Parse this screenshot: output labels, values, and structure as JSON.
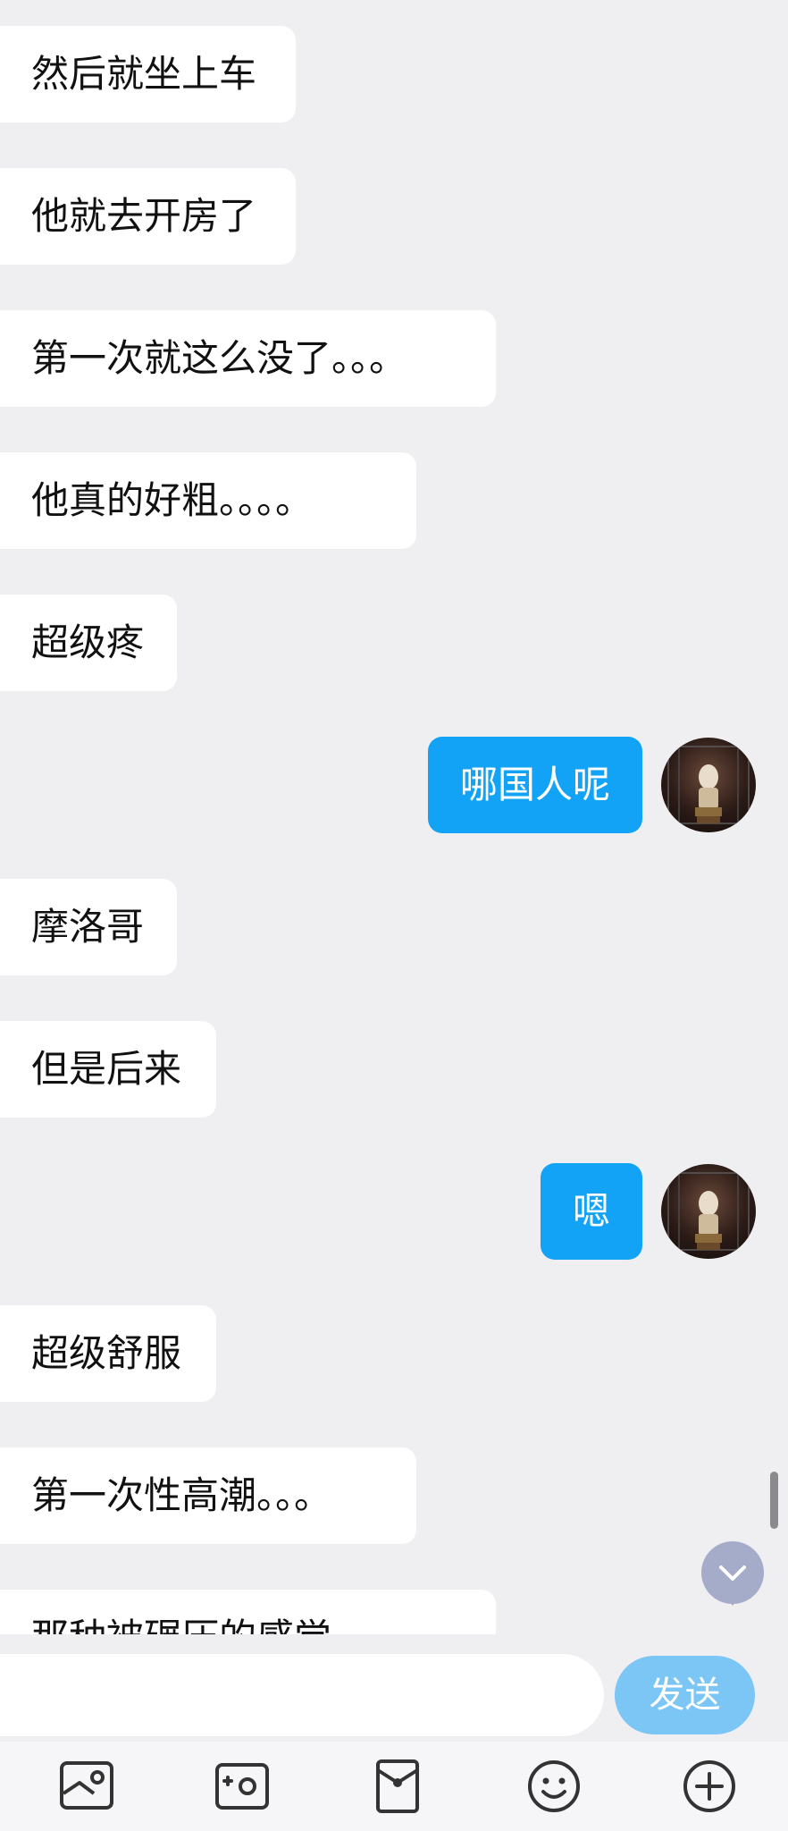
{
  "messages": [
    {
      "side": "in",
      "text": "然后就坐上车"
    },
    {
      "side": "in",
      "text": "他就去开房了"
    },
    {
      "side": "in",
      "text": "第一次就这么没了。。。"
    },
    {
      "side": "in",
      "text": "他真的好粗。。。。"
    },
    {
      "side": "in",
      "text": "超级疼"
    },
    {
      "side": "out",
      "text": "哪国人呢"
    },
    {
      "side": "in",
      "text": "摩洛哥"
    },
    {
      "side": "in",
      "text": "但是后来"
    },
    {
      "side": "out",
      "text": "嗯"
    },
    {
      "side": "in",
      "text": "超级舒服"
    },
    {
      "side": "in",
      "text": "第一次性高潮。。。"
    },
    {
      "side": "in",
      "text": "那种被碾压的感觉"
    }
  ],
  "composer": {
    "input_value": "",
    "send_label": "发送"
  },
  "toolbar": {
    "icons": [
      "image-icon",
      "camera-icon",
      "red-packet-icon",
      "emoji-icon",
      "plus-icon"
    ]
  },
  "colors": {
    "background": "#efeff1",
    "incoming_bubble": "#ffffff",
    "outgoing_bubble": "#12a3f7",
    "send_button": "#7cc6f6",
    "scroll_down_button": "#a5acc9"
  }
}
